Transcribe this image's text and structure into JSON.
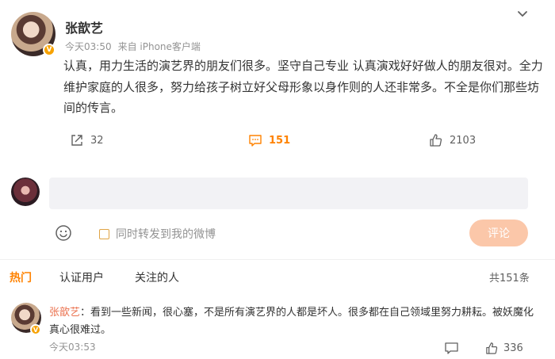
{
  "post": {
    "author": "张歆艺",
    "time": "今天03:50",
    "source": "来自 iPhone客户端",
    "content": "认真，用力生活的演艺界的朋友们很多。坚守自己专业 认真演戏好好做人的朋友很对。全力维护家庭的人很多，努力给孩子树立好父母形象以身作则的人还非常多。不全是你们那些坊间的传言。",
    "verified_badge": "V",
    "icons": [
      "chevron-down-icon",
      "share-icon",
      "comment-icon",
      "like-icon"
    ]
  },
  "actions": {
    "forward_count": "32",
    "comment_count": "151",
    "like_count": "2103"
  },
  "composer": {
    "input_value": "",
    "forward_checkbox_label": "同时转发到我的微博",
    "submit_label": "评论",
    "icons": [
      "emoji-icon"
    ]
  },
  "tabs": {
    "hot": "热门",
    "verified": "认证用户",
    "following": "关注的人",
    "total": "共151条"
  },
  "comments": [
    {
      "author": "张歆艺",
      "separator": "：",
      "text": "看到一些新闻，很心塞，不是所有演艺界的人都是坏人。很多都在自己领域里努力耕耘。被妖魔化真心很难过。",
      "time": "今天03:53",
      "like_count": "336"
    }
  ],
  "colors": {
    "accent": "#ff8200",
    "name_link": "#eb7350",
    "submit_disabled": "#fbc7a9",
    "badge": "#f7a200"
  }
}
